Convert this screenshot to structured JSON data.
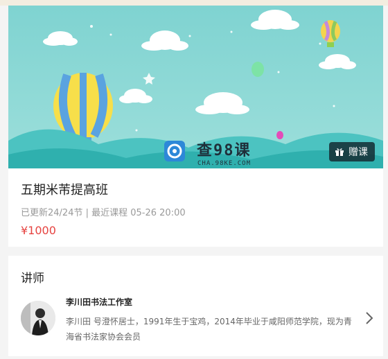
{
  "banner": {
    "watermark_title": "查98课",
    "watermark_url": "CHA.98KE.COM",
    "gift_label": "赠课",
    "colors": {
      "sky": "#8ed8d6",
      "hills": "#4cc3c1"
    }
  },
  "course": {
    "title": "五期米芾提高班",
    "meta": "已更新24/24节 | 最近课程 05-26 20:00",
    "price": "¥1000",
    "price_color": "#e64340"
  },
  "teacher_section": {
    "title": "讲师",
    "name": "李川田书法工作室",
    "description": "李川田 号澄怀居士，1991年生于宝鸡，2014年毕业于咸阳师范学院，现为青海省书法家协会会员"
  },
  "icons": {
    "gift": "gift-icon",
    "chevron": "chevron-right-icon",
    "logo": "cha98ke-logo-icon"
  }
}
